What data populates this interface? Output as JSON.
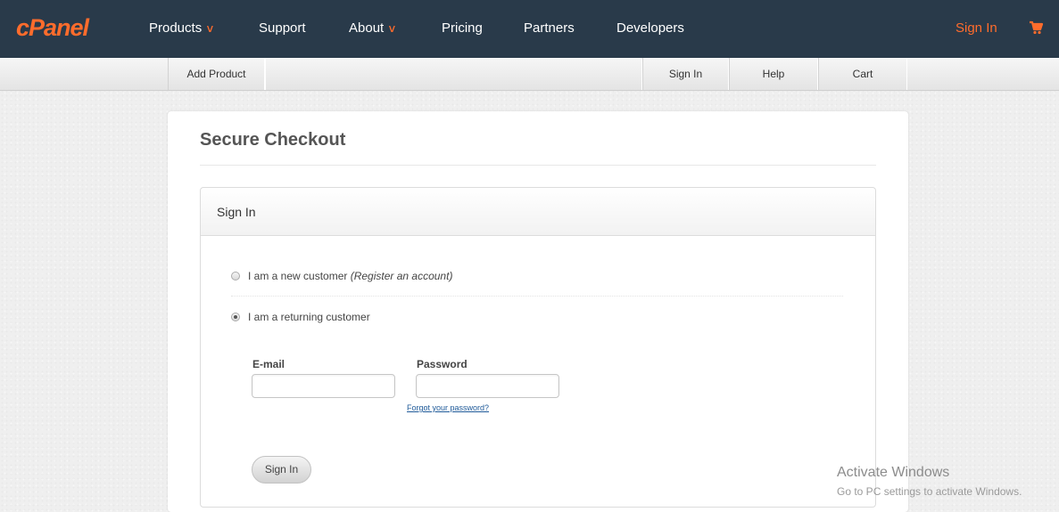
{
  "topnav": {
    "logo": "cPanel",
    "items": [
      {
        "label": "Products",
        "dropdown": true
      },
      {
        "label": "Support",
        "dropdown": false
      },
      {
        "label": "About",
        "dropdown": true
      },
      {
        "label": "Pricing",
        "dropdown": false
      },
      {
        "label": "Partners",
        "dropdown": false
      },
      {
        "label": "Developers",
        "dropdown": false
      }
    ],
    "signin": "Sign In",
    "cart_icon": "cart-icon",
    "colors": {
      "bar": "#293a4a",
      "accent": "#ff6c2c"
    }
  },
  "subnav": {
    "add_product": "Add Product",
    "sign_in": "Sign In",
    "help": "Help",
    "cart": "Cart"
  },
  "checkout": {
    "title": "Secure Checkout",
    "box_title": "Sign In",
    "new_customer": "I am a new customer",
    "register": "(Register an account)",
    "returning_customer": "I am a returning customer",
    "selected": "returning",
    "email_label": "E-mail",
    "email_value": "",
    "password_label": "Password",
    "password_value": "",
    "forgot": "Forgot your password?",
    "signin_button": "Sign In"
  },
  "watermark": {
    "title": "Activate Windows",
    "subtitle": "Go to PC settings to activate Windows."
  }
}
